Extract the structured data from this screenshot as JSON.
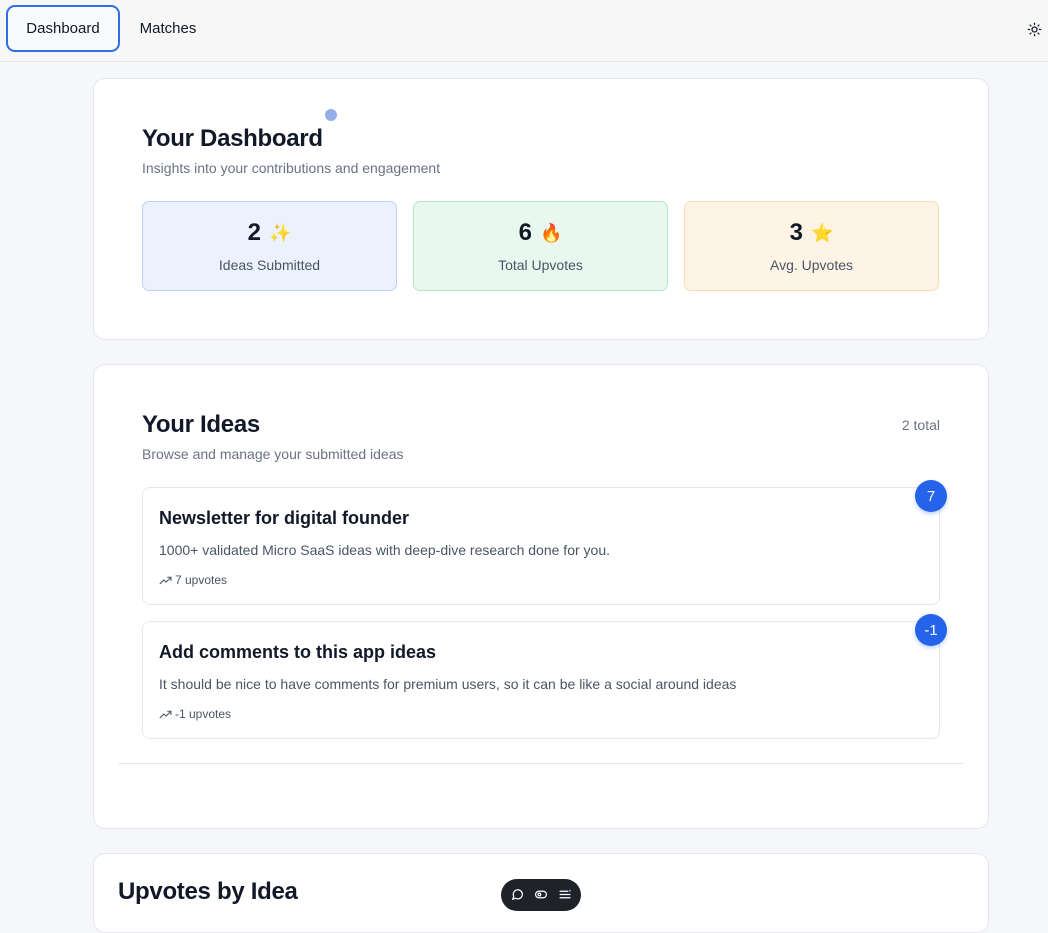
{
  "nav": {
    "tabs": [
      {
        "label": "Dashboard",
        "active": true
      },
      {
        "label": "Matches",
        "active": false
      }
    ],
    "theme_toggle_icon": "sun-icon"
  },
  "dashboard": {
    "title": "Your Dashboard",
    "subtitle": "Insights into your contributions and engagement",
    "stats": [
      {
        "value": "2",
        "emoji": "✨",
        "label": "Ideas Submitted",
        "color": "#ebf1fd"
      },
      {
        "value": "6",
        "emoji": "🔥",
        "label": "Total Upvotes",
        "color": "#e9f8ef"
      },
      {
        "value": "3",
        "emoji": "⭐",
        "label": "Avg. Upvotes",
        "color": "#fef4e6"
      }
    ]
  },
  "ideas": {
    "title": "Your Ideas",
    "subtitle": "Browse and manage your submitted ideas",
    "total": "2 total",
    "items": [
      {
        "title": "Newsletter for digital founder",
        "description": "1000+ validated Micro SaaS ideas with deep-dive research done for you.",
        "upvotes_text": "7 upvotes",
        "badge": "7"
      },
      {
        "title": "Add comments to this app ideas",
        "description": "It should be nice to have comments for premium users, so it can be like a social around ideas",
        "upvotes_text": "-1 upvotes",
        "badge": "-1"
      }
    ]
  },
  "upvotes_by_idea": {
    "title": "Upvotes by Idea"
  },
  "toolbar": {
    "icons": [
      "comment-icon",
      "toggle-icon",
      "list-icon"
    ]
  },
  "colors": {
    "accent": "#2563eb",
    "active_tab_border": "#2f6ee5"
  }
}
